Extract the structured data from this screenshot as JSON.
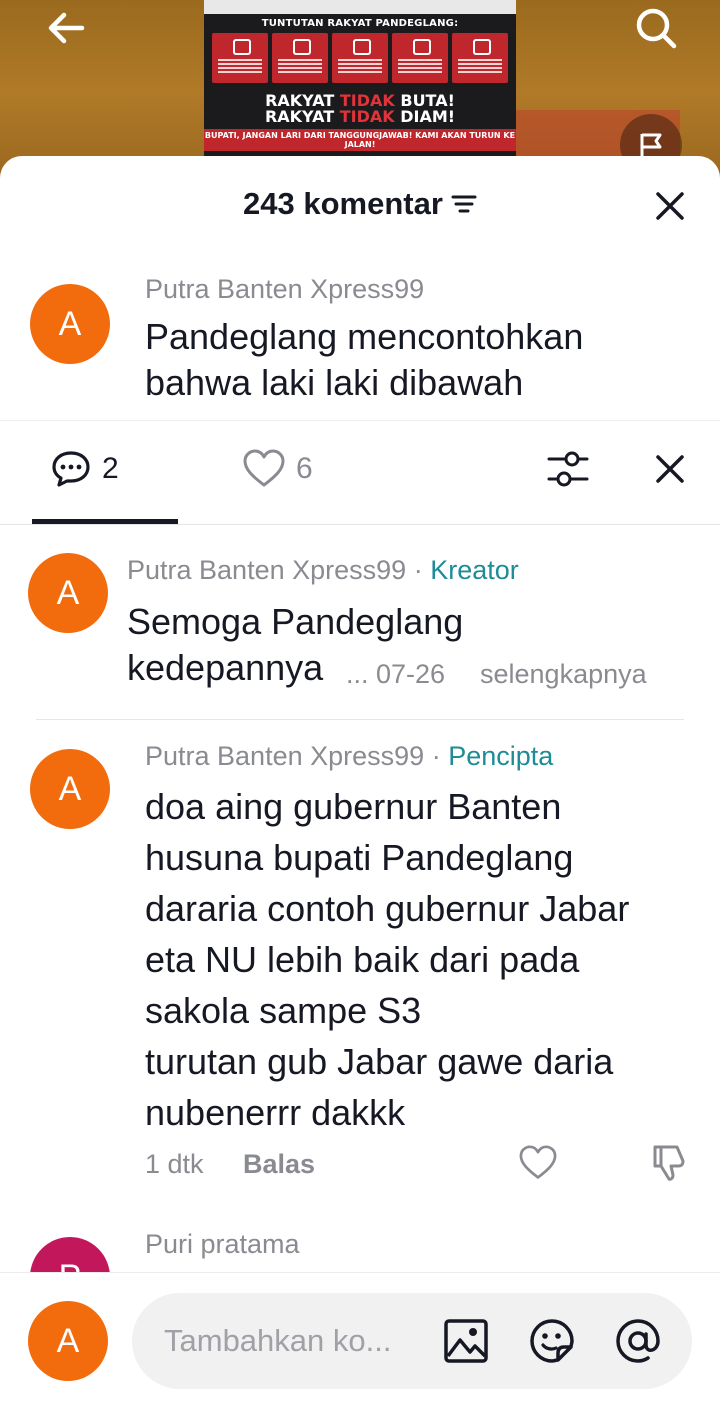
{
  "sheet": {
    "comment_count_label": "243 komentar",
    "icons": {
      "sort": "sort-lines-icon",
      "close": "close-icon"
    }
  },
  "parent_comment": {
    "avatar_letter": "A",
    "username": "Putra Banten Xpress99",
    "text": "Pandeglang mencontohkan bahwa laki laki dibawah"
  },
  "reply_panel": {
    "tabs": [
      {
        "icon": "chat-bubble-icon",
        "count": "2"
      },
      {
        "icon": "heart-outline-icon",
        "count": "6"
      }
    ],
    "icons": {
      "filter": "sliders-icon",
      "close": "close-icon"
    },
    "replies": [
      {
        "avatar_letter": "A",
        "username": "Putra Banten Xpress99",
        "separator": " · ",
        "badge": "Kreator",
        "lines": [
          "Semoga Pandeglang",
          "kedepannya"
        ],
        "ellipsis_date": "... 07-26",
        "more_label": "selengkapnya"
      },
      {
        "avatar_letter": "A",
        "username": "Putra Banten Xpress99",
        "separator": " · ",
        "badge": "Pencipta",
        "lines": [
          "doa aing gubernur Banten",
          "husuna bupati Pandeglang",
          "dararia contoh gubernur Jabar",
          "eta NU lebih baik dari pada",
          "sakola sampe S3",
          "turutan gub Jabar gawe daria",
          "nubenerrr dakkk"
        ],
        "time": "1 dtk",
        "reply_label": "Balas",
        "icons": {
          "like": "heart-outline-icon",
          "dislike": "thumbs-down-icon"
        }
      },
      {
        "avatar_letter": "P",
        "username": "Puri pratama"
      }
    ]
  },
  "composer": {
    "avatar_letter": "A",
    "placeholder": "Tambahkan ko...",
    "icons": [
      "image-icon",
      "emoji-icon",
      "mention-icon"
    ]
  },
  "video": {
    "poster_title": "TUNTUTAN RAKYAT PANDEGLANG:",
    "slogan_line1_a": "RAKYAT ",
    "slogan_line1_b": "TIDAK",
    "slogan_line1_c": " BUTA!",
    "slogan_line2_a": "RAKYAT ",
    "slogan_line2_b": "TIDAK",
    "slogan_line2_c": " DIAM!",
    "poster_footer": "BUPATI, JANGAN LARI DARI TANGGUNGJAWAB! KAMI AKAN TURUN KE JALAN!",
    "icons": {
      "back": "back-arrow-icon",
      "search": "search-icon",
      "flag": "flag-icon"
    },
    "colors": {
      "accent_red": "#c0272d",
      "kreator_teal": "#1d8c97",
      "avatar_orange": "#f26c0d"
    }
  }
}
